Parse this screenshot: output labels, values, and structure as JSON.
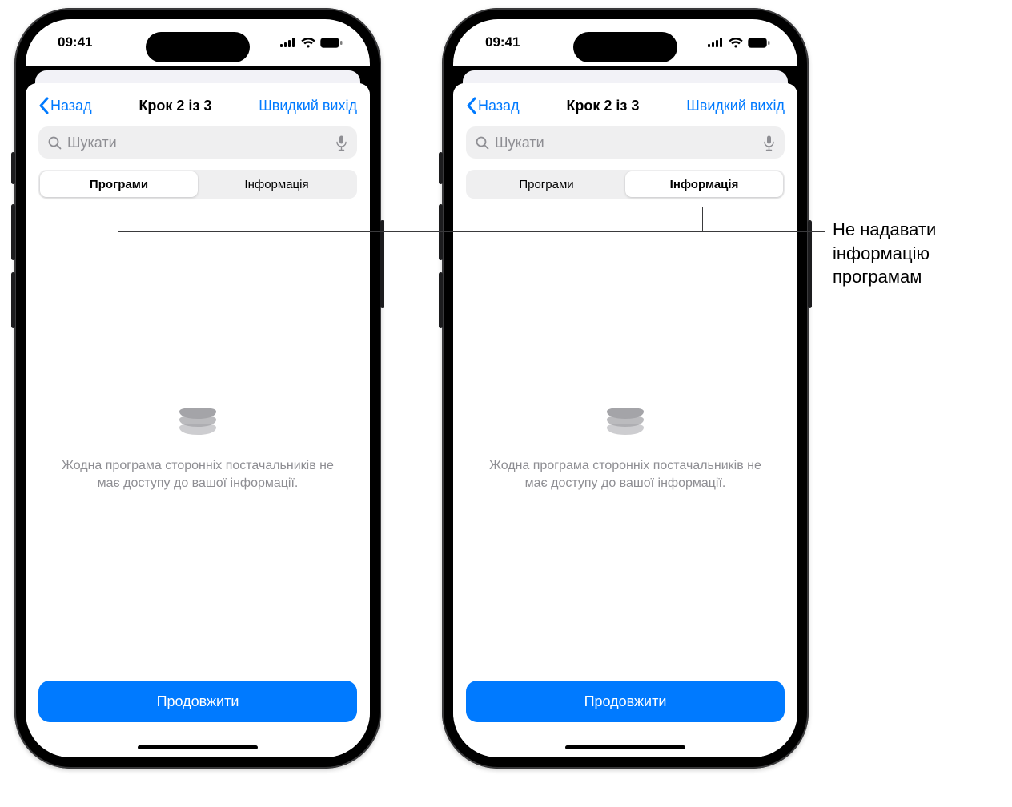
{
  "status": {
    "time": "09:41"
  },
  "nav": {
    "back_label": "Назад",
    "title": "Крок 2 із 3",
    "quick_exit": "Швидкий вихід"
  },
  "search": {
    "placeholder": "Шукати"
  },
  "segments": {
    "apps": "Програми",
    "info": "Інформація"
  },
  "empty_message": "Жодна програма сторонніх постачальників не має доступу до вашої інформації.",
  "continue_label": "Продовжити",
  "callout": "Не надавати інформацію програмам",
  "phones": [
    {
      "active_segment": "apps"
    },
    {
      "active_segment": "info"
    }
  ]
}
